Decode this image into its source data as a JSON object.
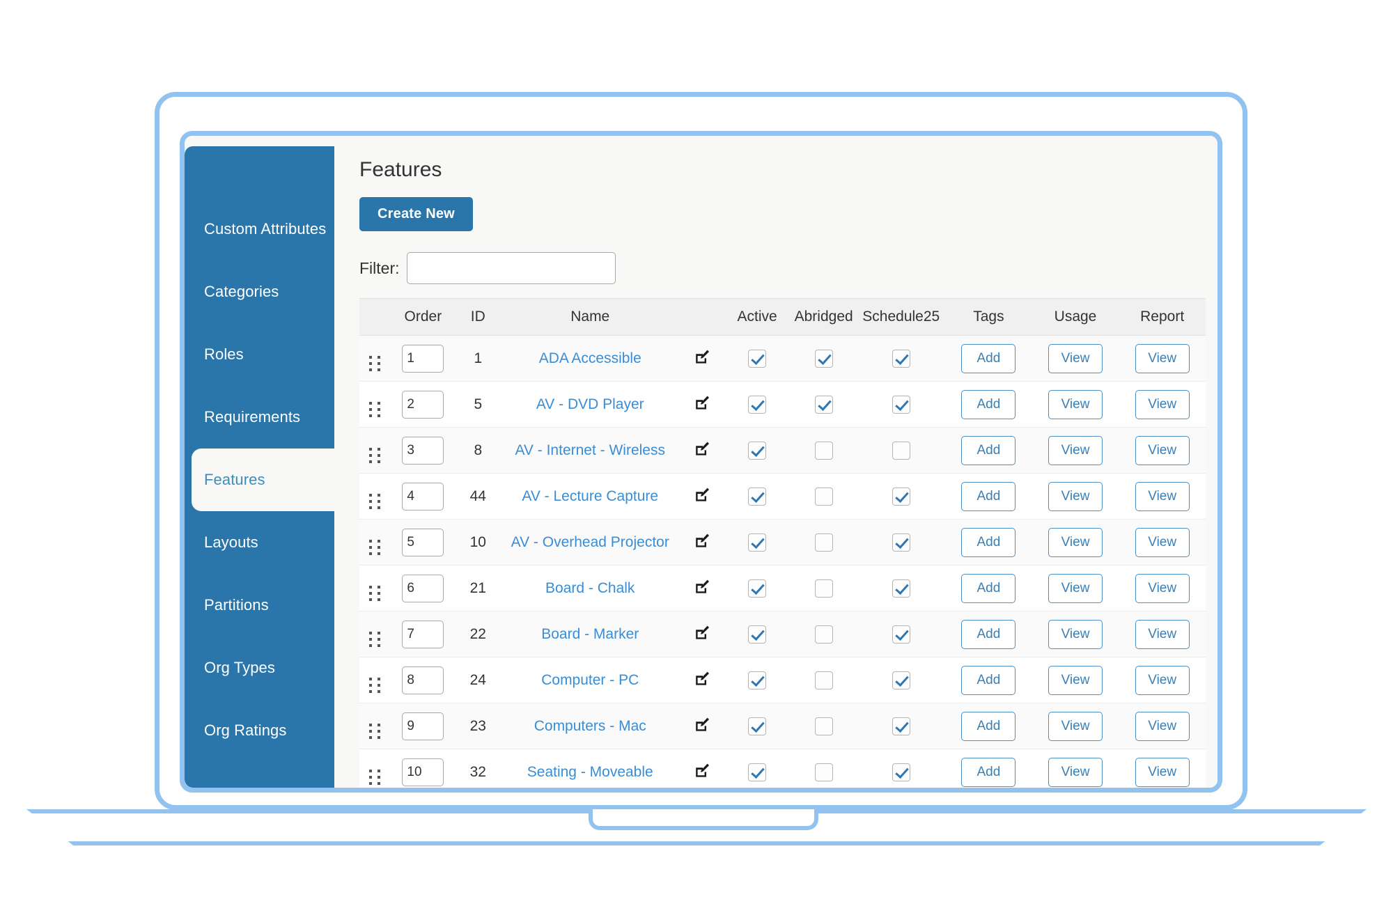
{
  "sidebar": {
    "items": [
      {
        "label": "Custom Attributes",
        "active": false
      },
      {
        "label": "Categories",
        "active": false
      },
      {
        "label": "Roles",
        "active": false
      },
      {
        "label": "Requirements",
        "active": false
      },
      {
        "label": "Features",
        "active": true
      },
      {
        "label": "Layouts",
        "active": false
      },
      {
        "label": "Partitions",
        "active": false
      },
      {
        "label": "Org Types",
        "active": false
      },
      {
        "label": "Org Ratings",
        "active": false
      }
    ]
  },
  "main": {
    "title": "Features",
    "create_button": "Create New",
    "filter_label": "Filter:",
    "filter_value": "",
    "filter_placeholder": ""
  },
  "table": {
    "columns": [
      "",
      "Order",
      "ID",
      "Name",
      "",
      "Active",
      "Abridged",
      "Schedule25",
      "Tags",
      "Usage",
      "Report"
    ],
    "row_action_labels": {
      "tags": "Add",
      "usage": "View",
      "report": "View"
    },
    "icons": {
      "drag": "drag-handle-icon",
      "edit": "edit-pencil-square-icon"
    },
    "rows": [
      {
        "order": "1",
        "id": "1",
        "name": "ADA Accessible",
        "active": true,
        "abridged": true,
        "schedule25": true,
        "tags": "Add",
        "usage": "View",
        "report": "View"
      },
      {
        "order": "2",
        "id": "5",
        "name": "AV - DVD Player",
        "active": true,
        "abridged": true,
        "schedule25": true,
        "tags": "Add",
        "usage": "View",
        "report": "View"
      },
      {
        "order": "3",
        "id": "8",
        "name": "AV - Internet - Wireless",
        "active": true,
        "abridged": false,
        "schedule25": false,
        "tags": "Add",
        "usage": "View",
        "report": "View"
      },
      {
        "order": "4",
        "id": "44",
        "name": "AV - Lecture Capture",
        "active": true,
        "abridged": false,
        "schedule25": true,
        "tags": "Add",
        "usage": "View",
        "report": "View"
      },
      {
        "order": "5",
        "id": "10",
        "name": "AV - Overhead Projector",
        "active": true,
        "abridged": false,
        "schedule25": true,
        "tags": "Add",
        "usage": "View",
        "report": "View"
      },
      {
        "order": "6",
        "id": "21",
        "name": "Board - Chalk",
        "active": true,
        "abridged": false,
        "schedule25": true,
        "tags": "Add",
        "usage": "View",
        "report": "View"
      },
      {
        "order": "7",
        "id": "22",
        "name": "Board - Marker",
        "active": true,
        "abridged": false,
        "schedule25": true,
        "tags": "Add",
        "usage": "View",
        "report": "View"
      },
      {
        "order": "8",
        "id": "24",
        "name": "Computer - PC",
        "active": true,
        "abridged": false,
        "schedule25": true,
        "tags": "Add",
        "usage": "View",
        "report": "View"
      },
      {
        "order": "9",
        "id": "23",
        "name": "Computers - Mac",
        "active": true,
        "abridged": false,
        "schedule25": true,
        "tags": "Add",
        "usage": "View",
        "report": "View"
      },
      {
        "order": "10",
        "id": "32",
        "name": "Seating - Moveable",
        "active": true,
        "abridged": false,
        "schedule25": true,
        "tags": "Add",
        "usage": "View",
        "report": "View"
      },
      {
        "order": "",
        "id": "",
        "name": "",
        "active": false,
        "abridged": false,
        "schedule25": false,
        "tags": "",
        "usage": "",
        "report": ""
      }
    ]
  },
  "colors": {
    "sidebar_blue": "#2a76ab",
    "accent_link": "#3a8dd4",
    "frame_blue": "#92c2ef",
    "page_bg": "#f8f8f7",
    "header_bg": "#f0f0f0"
  }
}
